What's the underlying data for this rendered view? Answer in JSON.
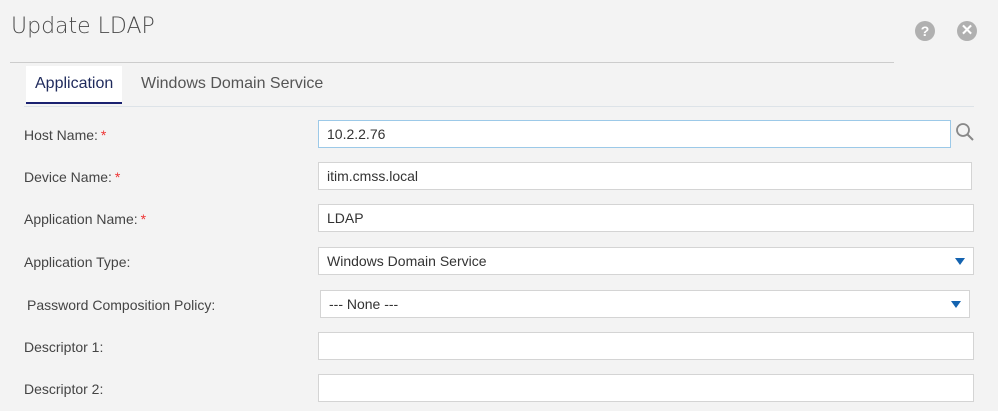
{
  "dialog": {
    "title": "Update LDAP"
  },
  "tabs": [
    {
      "label": "Application",
      "active": true
    },
    {
      "label": "Windows Domain Service",
      "active": false
    }
  ],
  "fields": [
    {
      "label": "Host Name:",
      "required": "*",
      "value": "10.2.2.76"
    },
    {
      "label": "Device Name:",
      "required": "*",
      "value": "itim.cmss.local"
    },
    {
      "label": "Application Name:",
      "required": "*",
      "value": "LDAP"
    },
    {
      "label": "Application Type:",
      "value": "Windows Domain Service"
    },
    {
      "label": "Password Composition Policy:",
      "value": "--- None ---"
    },
    {
      "label": "Descriptor 1:",
      "value": ""
    },
    {
      "label": "Descriptor 2:",
      "value": ""
    }
  ]
}
